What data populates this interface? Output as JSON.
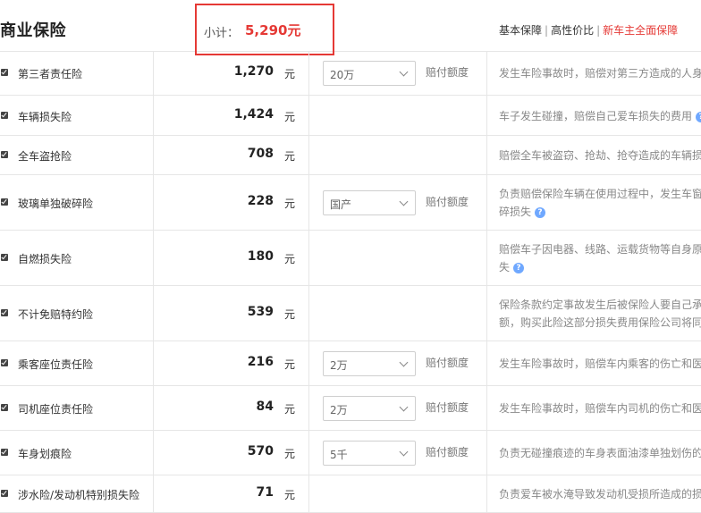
{
  "header": {
    "title": "商业保险",
    "subtotal_label": "小计：",
    "subtotal_value": "5,290元",
    "links": [
      "基本保障",
      "高性价比",
      "新车主全面保障"
    ],
    "active_link_index": 2,
    "accent_color": "#e53935"
  },
  "rows": [
    {
      "name": "第三者责任险",
      "price": "1,270",
      "unit": "元",
      "select": "20万",
      "pay_label": "赔付额度",
      "desc": [
        "发生车险事故时，赔偿对第三方造成的人身"
      ],
      "help_icon": false
    },
    {
      "name": "车辆损失险",
      "price": "1,424",
      "unit": "元",
      "select": null,
      "pay_label": null,
      "desc": [
        "车子发生碰撞，赔偿自己爱车损失的费用"
      ],
      "help_icon": true
    },
    {
      "name": "全车盗抢险",
      "price": "708",
      "unit": "元",
      "select": null,
      "pay_label": null,
      "desc": [
        "赔偿全车被盗窃、抢劫、抢夺造成的车辆损"
      ],
      "help_icon": false
    },
    {
      "name": "玻璃单独破碎险",
      "price": "228",
      "unit": "元",
      "select": "国产",
      "pay_label": "赔付额度",
      "desc": [
        "负责赔偿保险车辆在使用过程中，发生车窗",
        "碎损失"
      ],
      "help_icon": true
    },
    {
      "name": "自燃损失险",
      "price": "180",
      "unit": "元",
      "select": null,
      "pay_label": null,
      "desc": [
        "赔偿车子因电器、线路、运载货物等自身原",
        "失"
      ],
      "help_icon": true
    },
    {
      "name": "不计免赔特约险",
      "price": "539",
      "unit": "元",
      "select": null,
      "pay_label": null,
      "desc": [
        "保险条款约定事故发生后被保险人要自己承",
        "额，购买此险这部分损失费用保险公司将同"
      ],
      "help_icon": false
    },
    {
      "name": "乘客座位责任险",
      "price": "216",
      "unit": "元",
      "select": "2万",
      "pay_label": "赔付额度",
      "desc": [
        "发生车险事故时，赔偿车内乘客的伤亡和医"
      ],
      "help_icon": false
    },
    {
      "name": "司机座位责任险",
      "price": "84",
      "unit": "元",
      "select": "2万",
      "pay_label": "赔付额度",
      "desc": [
        "发生车险事故时，赔偿车内司机的伤亡和医"
      ],
      "help_icon": false
    },
    {
      "name": "车身划痕险",
      "price": "570",
      "unit": "元",
      "select": "5千",
      "pay_label": "赔付额度",
      "desc": [
        "负责无碰撞痕迹的车身表面油漆单独划伤的"
      ],
      "help_icon": false
    },
    {
      "name": "涉水险/发动机特别损失险",
      "price": "71",
      "unit": "元",
      "select": null,
      "pay_label": null,
      "desc": [
        "负责爱车被水淹导致发动机受损所造成的损"
      ],
      "help_icon": false
    }
  ]
}
